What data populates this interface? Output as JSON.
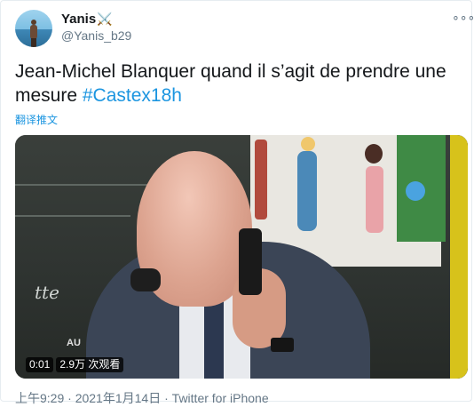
{
  "user": {
    "display_name": "Yanis",
    "name_emoji": "⚔️",
    "handle": "@Yanis_b29"
  },
  "more_menu": {
    "icon": "more-horizontal-icon",
    "glyph": "∘∘∘"
  },
  "tweet": {
    "text": "Jean-Michel Blanquer quand il s’agit de prendre une mesure",
    "hashtag": "#Castex18h",
    "translate_link": "翻译推文"
  },
  "media": {
    "type": "video",
    "duration": "0:01",
    "views": "2.9万 次观看",
    "overlay_text": "AU"
  },
  "footer": {
    "time": "上午9:29",
    "separator": " · ",
    "date": "2021年1月14日",
    "source_separator": " · ",
    "source": "Twitter for iPhone"
  },
  "colors": {
    "link": "#1b95e0",
    "text": "#14171a",
    "secondary": "#657786"
  }
}
